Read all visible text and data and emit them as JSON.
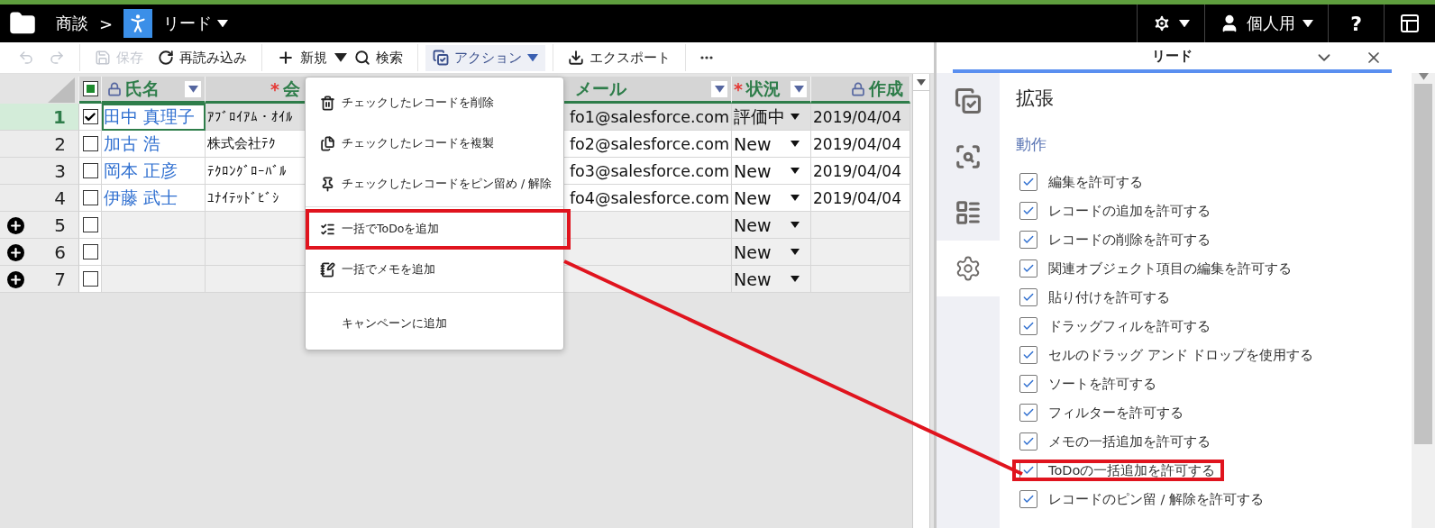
{
  "header": {
    "breadcrumb": "商談",
    "separator": ">",
    "current": "リード",
    "user": "個人用",
    "help": "?"
  },
  "toolbar": {
    "undo": {
      "disabled": true
    },
    "redo": {
      "disabled": true
    },
    "save": {
      "label": "保存",
      "disabled": true
    },
    "reload": {
      "label": "再読み込み",
      "disabled": false
    },
    "new": {
      "label": "新規"
    },
    "search": {
      "label": "検索"
    },
    "action": {
      "label": "アクション",
      "selected": true
    },
    "export": {
      "label": "エクスポート"
    }
  },
  "grid": {
    "select_all": {
      "indeterminate": true
    },
    "columns": [
      {
        "label": "氏名",
        "locked": true,
        "filter": true
      },
      {
        "label": "会",
        "locked": false,
        "required_mark": "*"
      },
      {
        "label": "メール",
        "locked": false,
        "filter": true
      },
      {
        "label": "状況",
        "locked": false,
        "required_mark": "*",
        "filter": true
      },
      {
        "label": "作成",
        "locked": true,
        "filter": false
      }
    ],
    "rows": [
      {
        "number": "1",
        "selected": true,
        "checked": true,
        "new": false,
        "name": "田中 真理子",
        "company": "ｱﾌﾞﾛｲｱﾑ・ｵｲﾙ",
        "email": "fo1@salesforce.com",
        "status": "評価中",
        "created": "2019/04/04"
      },
      {
        "number": "2",
        "selected": false,
        "checked": false,
        "new": false,
        "name": "加古 浩",
        "company": "株式会社ﾃｸ",
        "email": "fo2@salesforce.com",
        "status": "New",
        "created": "2019/04/04"
      },
      {
        "number": "3",
        "selected": false,
        "checked": false,
        "new": false,
        "name": "岡本 正彦",
        "company": "ﾃｸﾛﾝｸﾞﾛｰﾊﾞﾙ",
        "email": "fo3@salesforce.com",
        "status": "New",
        "created": "2019/04/04"
      },
      {
        "number": "4",
        "selected": false,
        "checked": false,
        "new": false,
        "name": "伊藤 武士",
        "company": "ﾕﾅｲﾃｯﾄﾞﾋﾞｼ",
        "email": "fo4@salesforce.com",
        "status": "New",
        "created": "2019/04/04"
      },
      {
        "number": "5",
        "selected": false,
        "checked": false,
        "new": true,
        "status": "New"
      },
      {
        "number": "6",
        "selected": false,
        "checked": false,
        "new": true,
        "status": "New"
      },
      {
        "number": "7",
        "selected": false,
        "checked": false,
        "new": true,
        "status": "New"
      }
    ]
  },
  "action_menu": {
    "groups": [
      [
        {
          "label": "チェックしたレコードを削除",
          "highlighted": false
        },
        {
          "label": "チェックしたレコードを複製",
          "highlighted": false
        },
        {
          "label": "チェックしたレコードをピン留め / 解除",
          "highlighted": false
        }
      ],
      [
        {
          "label": "一括でToDoを追加",
          "highlighted": true
        },
        {
          "label": "一括でメモを追加",
          "highlighted": false
        }
      ],
      [
        {
          "label": "キャンペーンに追加",
          "highlighted": false
        }
      ]
    ]
  },
  "panel": {
    "title": "リード",
    "side_tabs": [
      {
        "selected": false
      },
      {
        "selected": false
      },
      {
        "selected": false
      },
      {
        "selected": true
      }
    ],
    "heading": "拡張",
    "section": "動作",
    "options": [
      {
        "label": "編集を許可する",
        "checked": true,
        "highlighted": false
      },
      {
        "label": "レコードの追加を許可する",
        "checked": true,
        "highlighted": false
      },
      {
        "label": "レコードの削除を許可する",
        "checked": true,
        "highlighted": false
      },
      {
        "label": "関連オブジェクト項目の編集を許可する",
        "checked": true,
        "highlighted": false
      },
      {
        "label": "貼り付けを許可する",
        "checked": true,
        "highlighted": false
      },
      {
        "label": "ドラッグフィルを許可する",
        "checked": true,
        "highlighted": false
      },
      {
        "label": "セルのドラッグ アンド ドロップを使用する",
        "checked": true,
        "highlighted": false
      },
      {
        "label": "ソートを許可する",
        "checked": true,
        "highlighted": false
      },
      {
        "label": "フィルターを許可する",
        "checked": true,
        "highlighted": false
      },
      {
        "label": "メモの一括追加を許可する",
        "checked": true,
        "highlighted": false
      },
      {
        "label": "ToDoの一括追加を許可する",
        "checked": true,
        "highlighted": true
      },
      {
        "label": "レコードのピン留 / 解除を許可する",
        "checked": true,
        "highlighted": false
      }
    ]
  }
}
